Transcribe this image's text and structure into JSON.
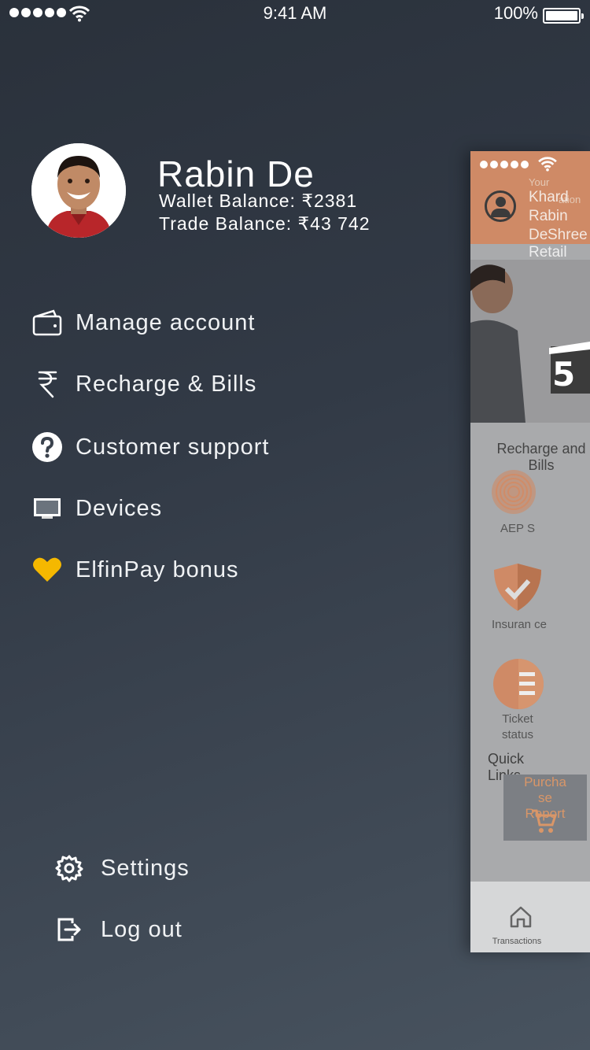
{
  "status_bar": {
    "time": "9:41 AM",
    "battery": "100%"
  },
  "profile": {
    "name": "Rabin De",
    "wallet_balance": "Wallet Balance: ₹2381",
    "trade_balance": "Trade Balance: ₹43 742"
  },
  "menu": {
    "items": [
      {
        "label": "Manage account",
        "icon": "wallet-icon"
      },
      {
        "label": "Recharge & Bills",
        "icon": "rupee-icon"
      },
      {
        "label": "Customer support",
        "icon": "question-icon"
      },
      {
        "label": "Devices",
        "icon": "device-icon"
      },
      {
        "label": "ElfinPay bonus",
        "icon": "heart-icon"
      }
    ]
  },
  "bottom_menu": {
    "settings": "Settings",
    "logout": "Log out"
  },
  "background_screen": {
    "header_lines": [
      "Khard",
      "Rabin",
      "De"
    ],
    "header_small": [
      "Your",
      "ation"
    ],
    "header_extra": [
      "Shree La",
      "Retail"
    ],
    "section_title": "Recharge and Bills",
    "tiles": [
      "AEP S",
      "Insuran ce",
      "Ticket status"
    ],
    "quick_links": "Quick Links",
    "purchase_report": "Purcha se Report",
    "tab_label": "Transactions",
    "accent_color": "#cf8a66"
  }
}
